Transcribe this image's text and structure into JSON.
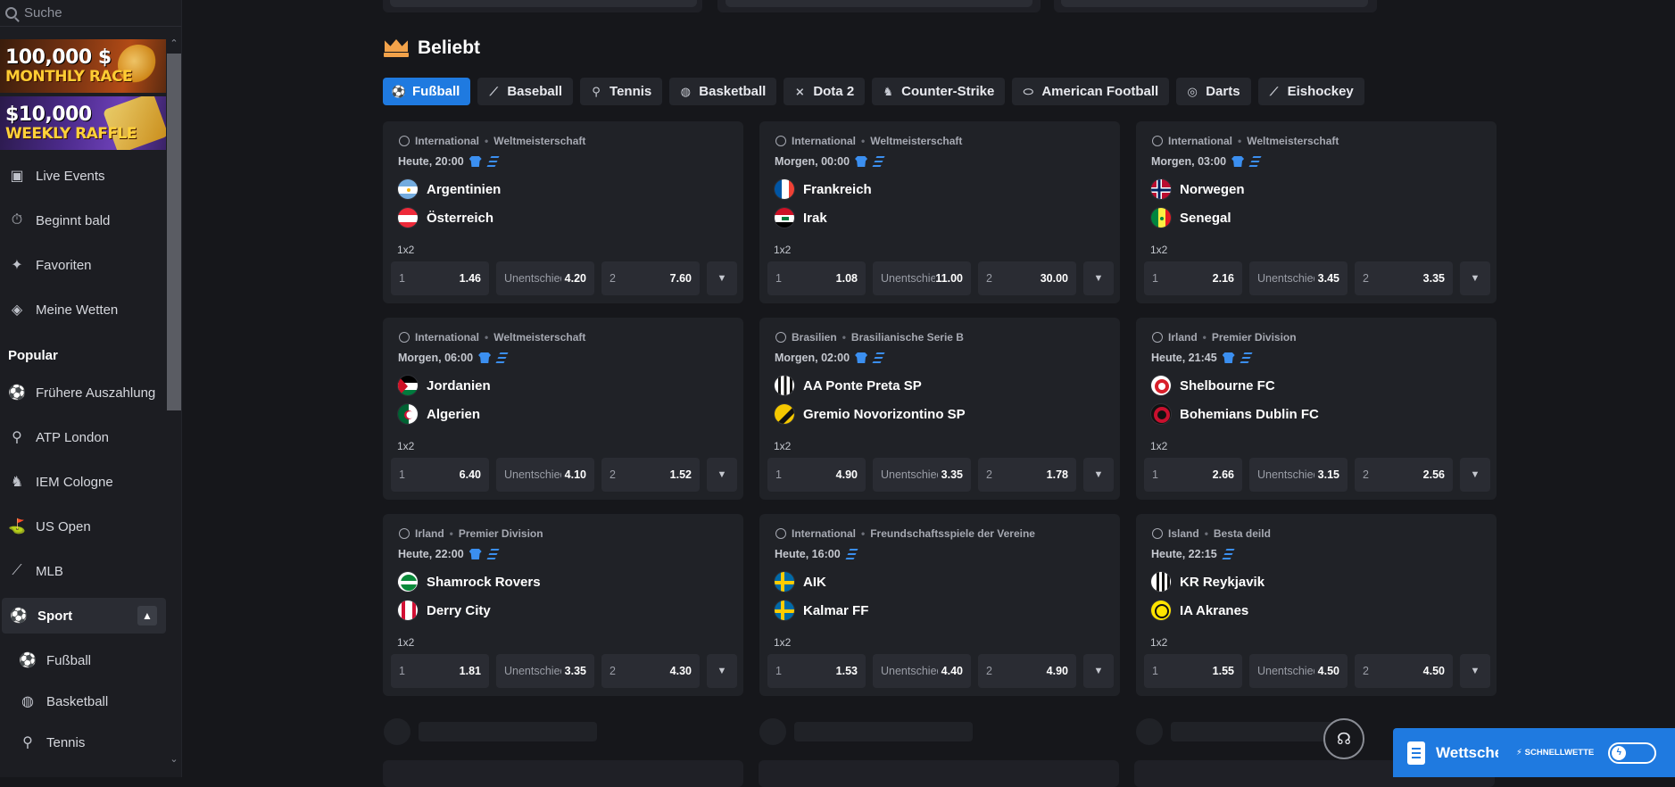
{
  "search": {
    "placeholder": "Suche"
  },
  "banners": [
    {
      "line1": "100,000 $",
      "line2": "MONTHLY RACE"
    },
    {
      "line1": "$10,000",
      "line2": "WEEKLY RAFFLE"
    }
  ],
  "sidebar": {
    "items": [
      {
        "label": "Live Events",
        "icon": "live-icon"
      },
      {
        "label": "Beginnt bald",
        "icon": "stopwatch-icon"
      },
      {
        "label": "Favoriten",
        "icon": "star-icon"
      },
      {
        "label": "Meine Wetten",
        "icon": "ticket-icon"
      }
    ],
    "popular_heading": "Popular",
    "popular": [
      {
        "label": "Frühere Auszahlung",
        "icon": "soccer-ball-icon"
      },
      {
        "label": "ATP London",
        "icon": "tennis-icon"
      },
      {
        "label": "IEM Cologne",
        "icon": "counter-strike-icon"
      },
      {
        "label": "US Open",
        "icon": "golf-icon"
      },
      {
        "label": "MLB",
        "icon": "baseball-bat-icon"
      }
    ],
    "sport_label": "Sport",
    "sport_sub": [
      {
        "label": "Fußball",
        "icon": "soccer-ball-icon"
      },
      {
        "label": "Basketball",
        "icon": "basketball-icon"
      },
      {
        "label": "Tennis",
        "icon": "tennis-icon"
      }
    ]
  },
  "section": {
    "title": "Beliebt"
  },
  "tabs": [
    {
      "label": "Fußball",
      "icon": "soccer-ball-icon",
      "active": true
    },
    {
      "label": "Baseball",
      "icon": "baseball-bat-icon"
    },
    {
      "label": "Tennis",
      "icon": "tennis-icon"
    },
    {
      "label": "Basketball",
      "icon": "basketball-icon"
    },
    {
      "label": "Dota 2",
      "icon": "dota-icon"
    },
    {
      "label": "Counter-Strike",
      "icon": "counter-strike-icon"
    },
    {
      "label": "American Football",
      "icon": "american-football-icon"
    },
    {
      "label": "Darts",
      "icon": "darts-icon"
    },
    {
      "label": "Eishockey",
      "icon": "hockey-icon"
    }
  ],
  "matches": [
    {
      "league": "International",
      "competition": "Weltmeisterschaft",
      "time": "Heute, 20:00",
      "jersey": true,
      "home": "Argentinien",
      "away": "Österreich",
      "home_flag": "argentina",
      "away_flag": "austria",
      "market": "1x2",
      "odds": {
        "home": "1.46",
        "draw_label": "Unentschieden",
        "draw": "4.20",
        "away": "7.60"
      }
    },
    {
      "league": "International",
      "competition": "Weltmeisterschaft",
      "time": "Morgen, 00:00",
      "jersey": true,
      "home": "Frankreich",
      "away": "Irak",
      "home_flag": "france",
      "away_flag": "iraq",
      "market": "1x2",
      "odds": {
        "home": "1.08",
        "draw_label": "Unentschieden",
        "draw": "11.00",
        "away": "30.00"
      }
    },
    {
      "league": "International",
      "competition": "Weltmeisterschaft",
      "time": "Morgen, 03:00",
      "jersey": true,
      "home": "Norwegen",
      "away": "Senegal",
      "home_flag": "norway",
      "away_flag": "senegal",
      "market": "1x2",
      "odds": {
        "home": "2.16",
        "draw_label": "Unentschieden",
        "draw": "3.45",
        "away": "3.35"
      }
    },
    {
      "league": "International",
      "competition": "Weltmeisterschaft",
      "time": "Morgen, 06:00",
      "jersey": true,
      "home": "Jordanien",
      "away": "Algerien",
      "home_flag": "jordan",
      "away_flag": "algeria",
      "market": "1x2",
      "odds": {
        "home": "6.40",
        "draw_label": "Unentschieden",
        "draw": "4.10",
        "away": "1.52"
      }
    },
    {
      "league": "Brasilien",
      "competition": "Brasilianische Serie B",
      "time": "Morgen, 02:00",
      "jersey": true,
      "home": "AA Ponte Preta SP",
      "away": "Gremio Novorizontino SP",
      "home_flag": "ponte",
      "away_flag": "novorizontino",
      "market": "1x2",
      "odds": {
        "home": "4.90",
        "draw_label": "Unentschieden",
        "draw": "3.35",
        "away": "1.78"
      }
    },
    {
      "league": "Irland",
      "competition": "Premier Division",
      "time": "Heute, 21:45",
      "jersey": true,
      "home": "Shelbourne FC",
      "away": "Bohemians Dublin FC",
      "home_flag": "shelbourne",
      "away_flag": "bohemians",
      "market": "1x2",
      "odds": {
        "home": "2.66",
        "draw_label": "Unentschieden",
        "draw": "3.15",
        "away": "2.56"
      }
    },
    {
      "league": "Irland",
      "competition": "Premier Division",
      "time": "Heute, 22:00",
      "jersey": true,
      "home": "Shamrock Rovers",
      "away": "Derry City",
      "home_flag": "shamrock",
      "away_flag": "derry",
      "market": "1x2",
      "odds": {
        "home": "1.81",
        "draw_label": "Unentschieden",
        "draw": "3.35",
        "away": "4.30"
      }
    },
    {
      "league": "International",
      "competition": "Freundschaftsspiele der Vereine",
      "time": "Heute, 16:00",
      "jersey": false,
      "home": "AIK",
      "away": "Kalmar FF",
      "home_flag": "sweden",
      "away_flag": "sweden",
      "market": "1x2",
      "odds": {
        "home": "1.53",
        "draw_label": "Unentschieden",
        "draw": "4.40",
        "away": "4.90"
      }
    },
    {
      "league": "Island",
      "competition": "Besta deild",
      "time": "Heute, 22:15",
      "jersey": false,
      "home": "KR Reykjavik",
      "away": "IA Akranes",
      "home_flag": "kr",
      "away_flag": "ia",
      "market": "1x2",
      "odds": {
        "home": "1.55",
        "draw_label": "Unentschieden",
        "draw": "4.50",
        "away": "4.50"
      }
    }
  ],
  "odds_labels": {
    "home": "1",
    "away": "2"
  },
  "betslip": {
    "title": "Wettschein",
    "quick_label": "SCHNELLWETTE"
  },
  "colors": {
    "accent": "#1f7ae0",
    "background": "#16171b",
    "card": "#202227"
  }
}
